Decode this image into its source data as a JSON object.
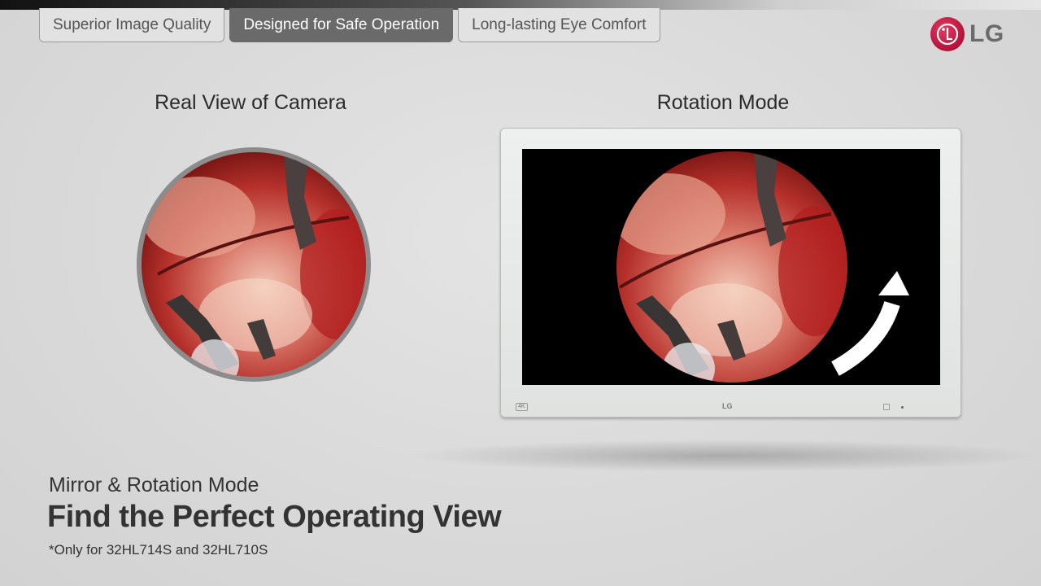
{
  "tabs": [
    {
      "label": "Superior Image Quality",
      "active": false
    },
    {
      "label": "Designed for Safe Operation",
      "active": true
    },
    {
      "label": "Long-lasting Eye Comfort",
      "active": false
    }
  ],
  "brand": {
    "name": "LG",
    "color": "#a50034"
  },
  "left_panel": {
    "title": "Real View of Camera"
  },
  "right_panel": {
    "title": "Rotation Mode",
    "bezel_badge": "4K",
    "bezel_logo": "LG"
  },
  "caption": {
    "subtitle": "Mirror & Rotation Mode",
    "headline": "Find the Perfect Operating View",
    "footnote": "*Only for 32HL714S and 32HL710S"
  },
  "colors": {
    "active_tab": "#6a6a6a",
    "inactive_tab": "#e2e2e2",
    "monitor_screen": "#000000"
  }
}
